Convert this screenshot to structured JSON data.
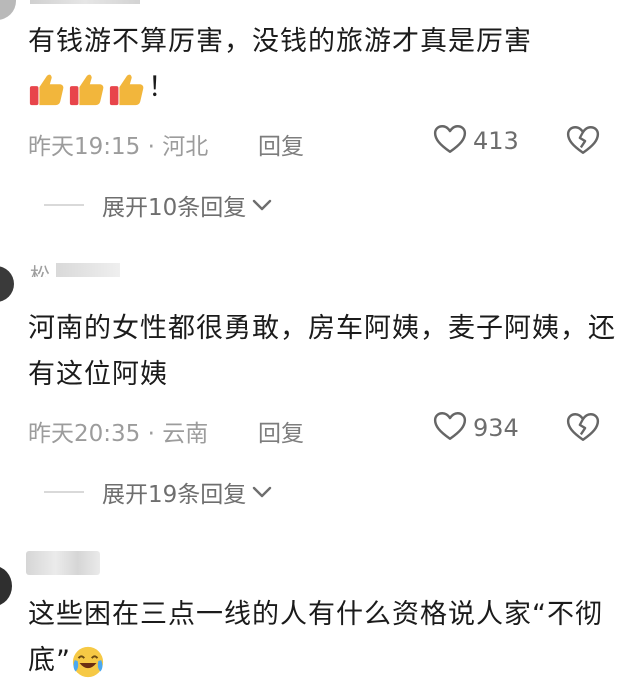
{
  "comments": [
    {
      "username": "",
      "text": "有钱游不算厉害，没钱的旅游才真是厉害",
      "emoji": [
        "thumbs-up-icon",
        "thumbs-up-icon",
        "thumbs-up-icon"
      ],
      "text_suffix": "！",
      "time": "昨天19:15",
      "location": "河北",
      "reply_label": "回复",
      "likes": "413",
      "expand_label": "展开10条回复"
    },
    {
      "username": "松",
      "text": "河南的女性都很勇敢，房车阿姨，麦子阿姨，还有这位阿姨",
      "time": "昨天20:35",
      "location": "云南",
      "reply_label": "回复",
      "likes": "934",
      "expand_label": "展开19条回复"
    },
    {
      "username": "",
      "text": "这些困在三点一线的人有什么资格说人家“不彻底”",
      "emoji": [
        "crying-laughing-icon"
      ]
    }
  ],
  "separator": " · ",
  "colors": {
    "text": "#1b1b1b",
    "meta": "#9c9c9c",
    "thumb": "#f2b63c",
    "cuff": "#e8454b"
  }
}
